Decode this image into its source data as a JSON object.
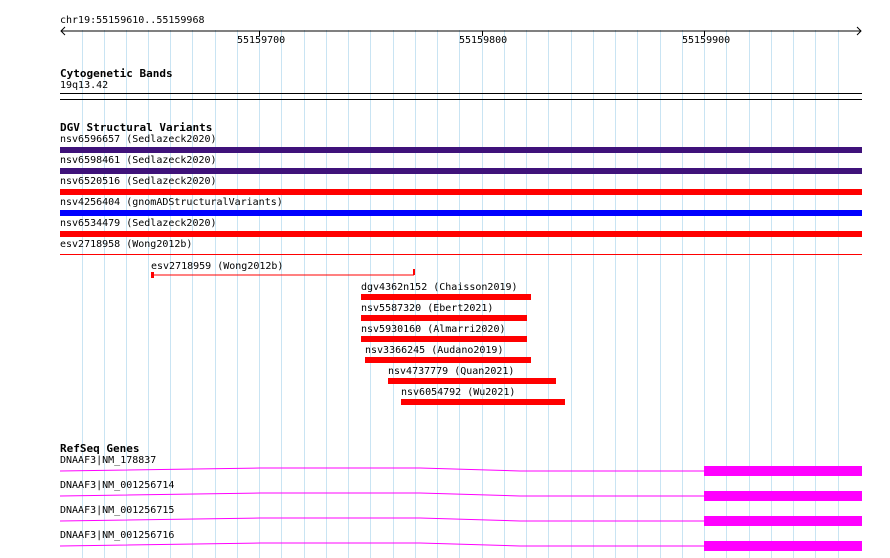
{
  "ruler": {
    "location": "chr19:55159610..55159968",
    "ticks": [
      "55159700",
      "55159800",
      "55159900"
    ]
  },
  "cytoband": {
    "title": "Cytogenetic Bands",
    "band": "19q13.42"
  },
  "dgv": {
    "title": "DGV Structural Variants",
    "full_width": [
      {
        "label": "nsv6596657 (Sedlazeck2020)",
        "color": "#3f127a"
      },
      {
        "label": "nsv6598461 (Sedlazeck2020)",
        "color": "#3f127a"
      },
      {
        "label": "nsv6520516 (Sedlazeck2020)",
        "color": "#ff0000"
      },
      {
        "label": "nsv4256404 (gnomADStructuralVariants)",
        "color": "#0000ff"
      },
      {
        "label": "nsv6534479 (Sedlazeck2020)",
        "color": "#ff0000"
      },
      {
        "label": "esv2718958 (Wong2012b)",
        "color": "#ff0000"
      }
    ],
    "esv_interval": {
      "label": "esv2718959 (Wong2012b)",
      "color": "#ff0000"
    },
    "partial": [
      {
        "label": "dgv4362n152 (Chaisson2019)",
        "color": "#ff0000"
      },
      {
        "label": "nsv5587320 (Ebert2021)",
        "color": "#ff0000"
      },
      {
        "label": "nsv5930160 (Almarri2020)",
        "color": "#ff0000"
      },
      {
        "label": "nsv3366245 (Audano2019)",
        "color": "#ff0000"
      },
      {
        "label": "nsv4737779 (Quan2021)",
        "color": "#ff0000"
      },
      {
        "label": "nsv6054792 (Wu2021)",
        "color": "#ff0000"
      }
    ]
  },
  "refseq": {
    "title": "RefSeq Genes",
    "color": "#ff00ff",
    "transcripts": [
      {
        "label": "DNAAF3|NM_178837"
      },
      {
        "label": "DNAAF3|NM_001256714"
      },
      {
        "label": "DNAAF3|NM_001256715"
      },
      {
        "label": "DNAAF3|NM_001256716"
      }
    ]
  }
}
